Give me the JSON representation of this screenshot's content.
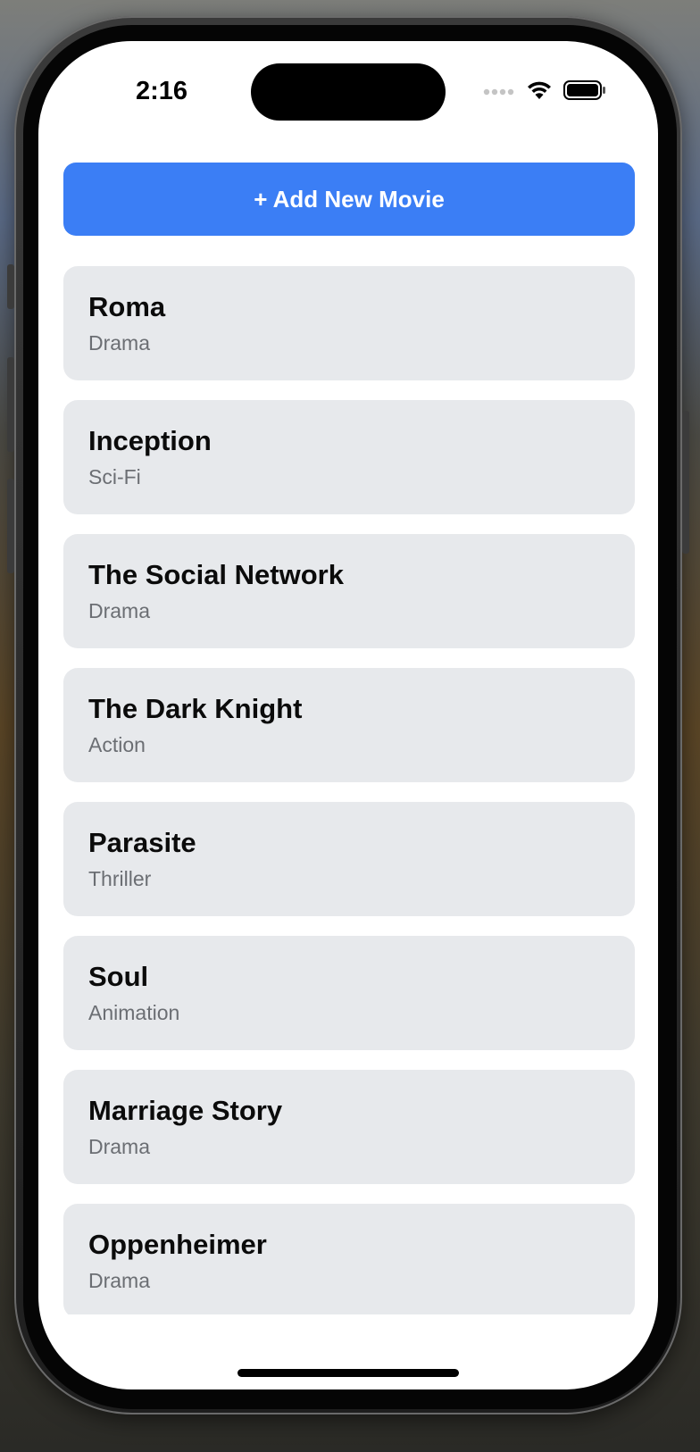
{
  "status_bar": {
    "time": "2:16",
    "signal_icon": "cellular-dots-icon",
    "wifi_icon": "wifi-icon",
    "battery_icon": "battery-full-icon"
  },
  "add_button": {
    "label": "+ Add New Movie",
    "color": "#3b7ef5"
  },
  "movies": [
    {
      "title": "Roma",
      "genre": "Drama"
    },
    {
      "title": "Inception",
      "genre": "Sci-Fi"
    },
    {
      "title": "The Social Network",
      "genre": "Drama"
    },
    {
      "title": "The Dark Knight",
      "genre": "Action"
    },
    {
      "title": "Parasite",
      "genre": "Thriller"
    },
    {
      "title": "Soul",
      "genre": "Animation"
    },
    {
      "title": "Marriage Story",
      "genre": "Drama"
    },
    {
      "title": "Oppenheimer",
      "genre": "Drama"
    }
  ],
  "colors": {
    "card_background": "#e7e9ec",
    "title_text": "#0b0b0b",
    "genre_text": "#6b6e73"
  }
}
